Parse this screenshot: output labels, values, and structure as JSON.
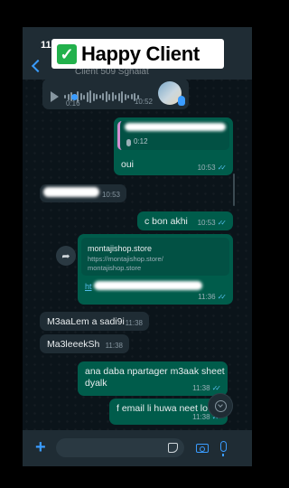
{
  "banner": {
    "check": "✓",
    "text": "Happy Client"
  },
  "status": {
    "time": "11"
  },
  "header": {
    "contact": "Client 509 Sghaiat"
  },
  "messages": {
    "voice": {
      "duration": "0:16",
      "time": "10:52"
    },
    "reply_oui": {
      "quote_duration": "0:12",
      "text": "oui",
      "time": "10:53"
    },
    "redacted_in": {
      "time": "10:53"
    },
    "c_bon_akhi": {
      "text": "c bon akhi",
      "time": "10:53"
    },
    "link": {
      "title": "montajishop.store",
      "desc_line1": "https://montajishop.store/",
      "desc_line2": "montajishop.store",
      "url_prefix": "ht",
      "time": "11:36"
    },
    "m3aalem": {
      "text": "M3aaLem a sadi9i",
      "time": "11:38"
    },
    "ma3leek": {
      "text": "Ma3leeekSh",
      "time": "11:38"
    },
    "npartager": {
      "line1": "ana daba npartager m3aak sheet",
      "line2": "dyalk",
      "time": "11:38"
    },
    "email": {
      "text": "f email li huwa neet lo",
      "time": "11:38"
    }
  },
  "icons": {
    "back": "chevron-left-icon",
    "forward": "forward-arrow-icon",
    "scroll": "chevron-down-circle-icon",
    "plus": "plus-icon",
    "sticker": "sticker-icon",
    "camera": "camera-icon",
    "mic": "microphone-icon"
  },
  "input": {
    "placeholder": ""
  },
  "colors": {
    "incoming": "#1f2c34",
    "outgoing": "#005c4b",
    "accent": "#3a9cff",
    "ticks": "#53bdeb"
  }
}
